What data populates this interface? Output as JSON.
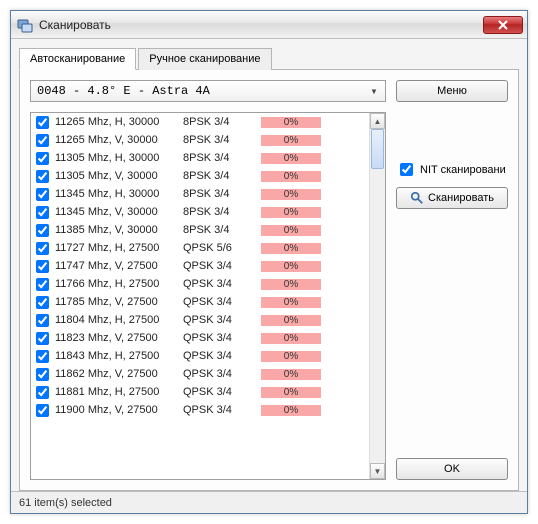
{
  "window": {
    "title": "Сканировать"
  },
  "tabs": {
    "auto": "Автосканирование",
    "manual": "Ручное сканирование"
  },
  "combo": {
    "value": "0048 -  4.8° E - Astra 4A"
  },
  "buttons": {
    "menu": "Меню",
    "scan": "Сканировать",
    "ok": "OK"
  },
  "nit": {
    "label": "NIT сканировани",
    "checked": true
  },
  "status": "61 item(s) selected",
  "rows": [
    {
      "checked": true,
      "freq": "11265 Mhz, H, 30000",
      "mod": "8PSK 3/4",
      "pct": "0%",
      "cls": "pink"
    },
    {
      "checked": true,
      "freq": "11265 Mhz, V, 30000",
      "mod": "8PSK 3/4",
      "pct": "0%",
      "cls": "pink"
    },
    {
      "checked": true,
      "freq": "11305 Mhz, H, 30000",
      "mod": "8PSK 3/4",
      "pct": "0%",
      "cls": "pink"
    },
    {
      "checked": true,
      "freq": "11305 Mhz, V, 30000",
      "mod": "8PSK 3/4",
      "pct": "0%",
      "cls": "pink"
    },
    {
      "checked": true,
      "freq": "11345 Mhz, H, 30000",
      "mod": "8PSK 3/4",
      "pct": "0%",
      "cls": "pink"
    },
    {
      "checked": true,
      "freq": "11345 Mhz, V, 30000",
      "mod": "8PSK 3/4",
      "pct": "0%",
      "cls": "pink"
    },
    {
      "checked": true,
      "freq": "11385 Mhz, V, 30000",
      "mod": "8PSK 3/4",
      "pct": "0%",
      "cls": "pink"
    },
    {
      "checked": true,
      "freq": "11727 Mhz, H, 27500",
      "mod": "QPSK 5/6",
      "pct": "0%",
      "cls": "pink"
    },
    {
      "checked": true,
      "freq": "11747 Mhz, V, 27500",
      "mod": "QPSK 3/4",
      "pct": "0%",
      "cls": "pink"
    },
    {
      "checked": true,
      "freq": "11766 Mhz, H, 27500",
      "mod": "QPSK 3/4",
      "pct": "0%",
      "cls": "pink"
    },
    {
      "checked": true,
      "freq": "11785 Mhz, V, 27500",
      "mod": "QPSK 3/4",
      "pct": "0%",
      "cls": "pink"
    },
    {
      "checked": true,
      "freq": "11804 Mhz, H, 27500",
      "mod": "QPSK 3/4",
      "pct": "0%",
      "cls": "pink"
    },
    {
      "checked": true,
      "freq": "11823 Mhz, V, 27500",
      "mod": "QPSK 3/4",
      "pct": "0%",
      "cls": "pink"
    },
    {
      "checked": true,
      "freq": "11843 Mhz, H, 27500",
      "mod": "QPSK 3/4",
      "pct": "0%",
      "cls": "pink"
    },
    {
      "checked": true,
      "freq": "11862 Mhz, V, 27500",
      "mod": "QPSK 3/4",
      "pct": "0%",
      "cls": "pink"
    },
    {
      "checked": true,
      "freq": "11881 Mhz, H, 27500",
      "mod": "QPSK 3/4",
      "pct": "0%",
      "cls": "pink"
    },
    {
      "checked": true,
      "freq": "11900 Mhz, V, 27500",
      "mod": "QPSK 3/4",
      "pct": "0%",
      "cls": "pink"
    }
  ]
}
